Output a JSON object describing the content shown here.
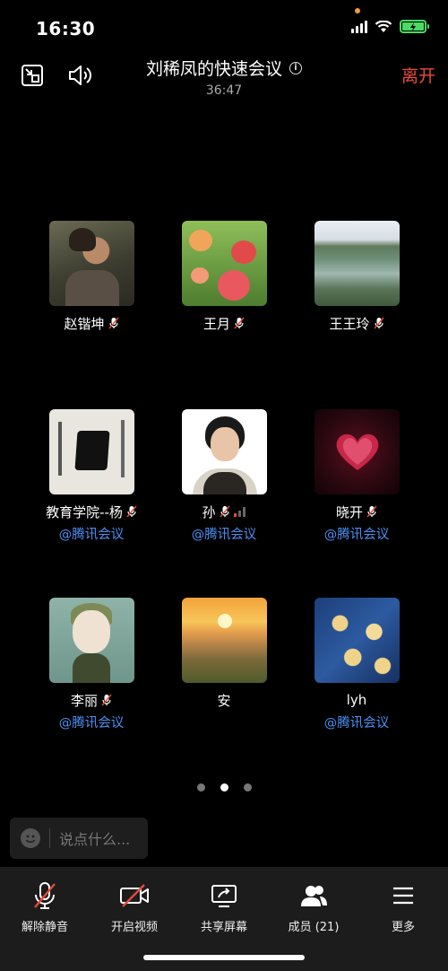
{
  "status": {
    "time": "16:30"
  },
  "header": {
    "title": "刘稀凤的快速会议",
    "timer": "36:47",
    "leave_label": "离开",
    "info_icon": "info-icon",
    "accent": "#ea4b3c"
  },
  "participants": [
    {
      "name": "赵锴坤",
      "muted": true,
      "tag": ""
    },
    {
      "name": "王月",
      "muted": true,
      "tag": ""
    },
    {
      "name": "王王玲",
      "muted": true,
      "tag": ""
    },
    {
      "name": "教育学院--杨",
      "muted": true,
      "tag": "@腾讯会议"
    },
    {
      "name": "孙",
      "muted": true,
      "tag": "@腾讯会议"
    },
    {
      "name": "晓开",
      "muted": true,
      "tag": "@腾讯会议"
    },
    {
      "name": "李丽",
      "muted": true,
      "tag": "@腾讯会议"
    },
    {
      "name": "安",
      "muted": false,
      "tag": ""
    },
    {
      "name": "lyh",
      "muted": false,
      "tag": "@腾讯会议"
    }
  ],
  "pager": {
    "count": 3,
    "active": 1
  },
  "chat": {
    "placeholder": "说点什么..."
  },
  "toolbar": {
    "unmute_label": "解除静音",
    "video_label": "开启视频",
    "share_label": "共享屏幕",
    "members_label": "成员 (21)",
    "more_label": "更多"
  },
  "colors": {
    "tag": "#4d8ff3",
    "toolbar_bg": "#1c1c1c"
  }
}
